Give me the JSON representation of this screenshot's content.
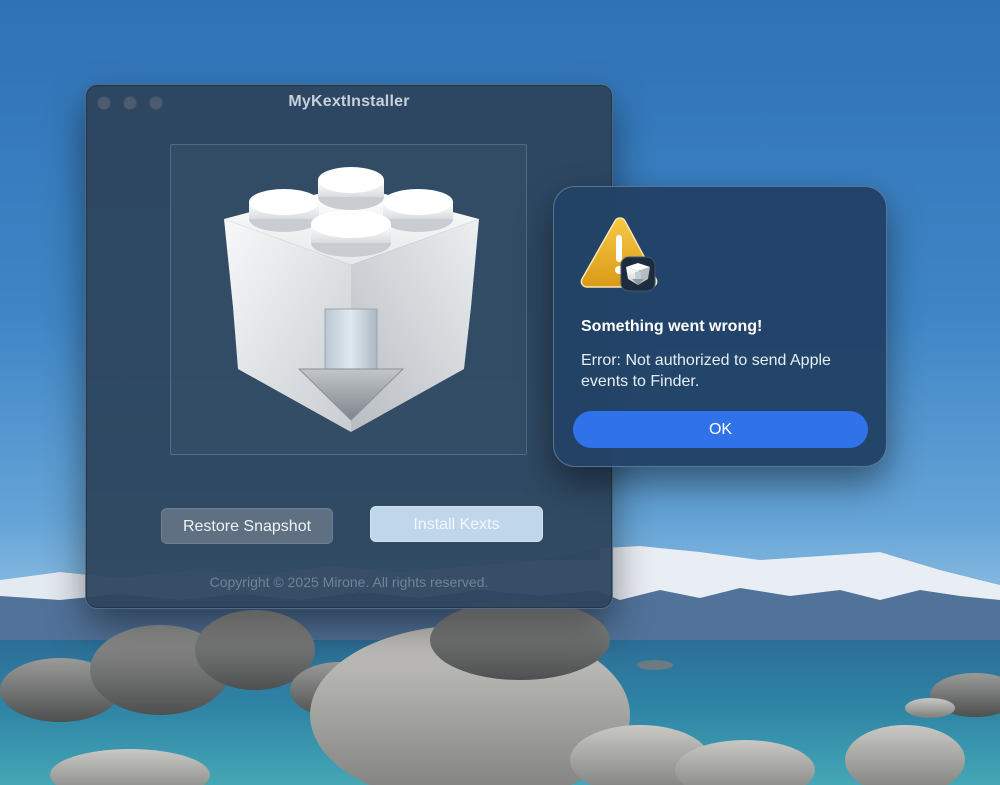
{
  "app_window": {
    "title": "MyKextInstaller",
    "icon": "kext-install-icon",
    "buttons": {
      "restore_snapshot": "Restore Snapshot",
      "install_kexts": "Install Kexts"
    },
    "copyright": "Copyright © 2025 Mirone. All rights reserved."
  },
  "alert": {
    "icon": "warning-icon",
    "title": "Something went wrong!",
    "message": "Error: Not authorized to send Apple events to Finder.",
    "ok_label": "OK"
  },
  "colors": {
    "accent": "#2f72e9",
    "window_bg": "#2d445c",
    "alert_bg": "#224266"
  }
}
